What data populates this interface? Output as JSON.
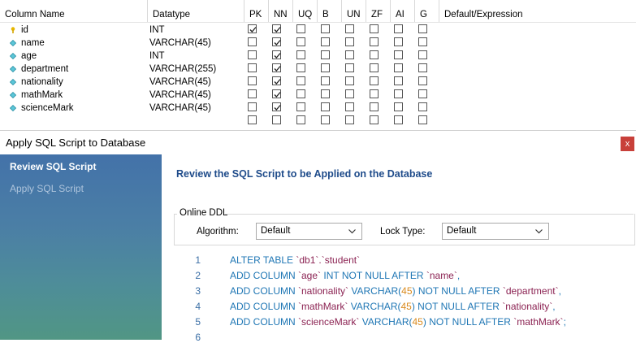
{
  "grid": {
    "headers": [
      "Column Name",
      "Datatype",
      "PK",
      "NN",
      "UQ",
      "B",
      "UN",
      "ZF",
      "AI",
      "G",
      "Default/Expression"
    ],
    "rows": [
      {
        "name": "id",
        "type": "INT",
        "icon": "key-icon",
        "pk": true,
        "nn": true
      },
      {
        "name": "name",
        "type": "VARCHAR(45)",
        "icon": "diamond-icon",
        "pk": false,
        "nn": true
      },
      {
        "name": "age",
        "type": "INT",
        "icon": "diamond-icon",
        "pk": false,
        "nn": true
      },
      {
        "name": "department",
        "type": "VARCHAR(255)",
        "icon": "diamond-icon",
        "pk": false,
        "nn": true
      },
      {
        "name": "nationality",
        "type": "VARCHAR(45)",
        "icon": "diamond-icon",
        "pk": false,
        "nn": true
      },
      {
        "name": "mathMark",
        "type": "VARCHAR(45)",
        "icon": "diamond-icon",
        "pk": false,
        "nn": true
      },
      {
        "name": "scienceMark",
        "type": "VARCHAR(45)",
        "icon": "diamond-icon",
        "pk": false,
        "nn": true
      },
      {
        "name": "",
        "type": "",
        "icon": "",
        "pk": false,
        "nn": false
      }
    ]
  },
  "dialog": {
    "title": "Apply SQL Script to Database",
    "close_label": "x",
    "steps": [
      "Review SQL Script",
      "Apply SQL Script"
    ],
    "heading": "Review the SQL Script to be Applied on the Database",
    "online_ddl": {
      "legend": "Online DDL",
      "algorithm_label": "Algorithm:",
      "algorithm_value": "Default",
      "lock_label": "Lock Type:",
      "lock_value": "Default"
    },
    "line_numbers": [
      "1",
      "2",
      "3",
      "4",
      "5",
      "6"
    ],
    "script": [
      [
        [
          "k",
          "ALTER TABLE "
        ],
        [
          "s",
          "`db1`.`student`"
        ]
      ],
      [
        [
          "k",
          "ADD COLUMN "
        ],
        [
          "s",
          "`age`"
        ],
        [
          "k",
          " INT NOT NULL AFTER "
        ],
        [
          "s",
          "`name`"
        ],
        [
          "k",
          ","
        ]
      ],
      [
        [
          "k",
          "ADD COLUMN "
        ],
        [
          "s",
          "`nationality`"
        ],
        [
          "k",
          " VARCHAR("
        ],
        [
          "n",
          "45"
        ],
        [
          "k",
          ") NOT NULL AFTER "
        ],
        [
          "s",
          "`department`"
        ],
        [
          "k",
          ","
        ]
      ],
      [
        [
          "k",
          "ADD COLUMN "
        ],
        [
          "s",
          "`mathMark`"
        ],
        [
          "k",
          " VARCHAR("
        ],
        [
          "n",
          "45"
        ],
        [
          "k",
          ") NOT NULL AFTER "
        ],
        [
          "s",
          "`nationality`"
        ],
        [
          "k",
          ","
        ]
      ],
      [
        [
          "k",
          "ADD COLUMN "
        ],
        [
          "s",
          "`scienceMark`"
        ],
        [
          "k",
          " VARCHAR("
        ],
        [
          "n",
          "45"
        ],
        [
          "k",
          ") NOT NULL AFTER "
        ],
        [
          "s",
          "`mathMark`"
        ],
        [
          "k",
          ";"
        ]
      ],
      []
    ]
  },
  "colors": {
    "keyword": "#1e76b4",
    "string": "#8b2252",
    "number": "#d98b1f",
    "heading": "#1e4b8a",
    "close": "#c8403a"
  }
}
